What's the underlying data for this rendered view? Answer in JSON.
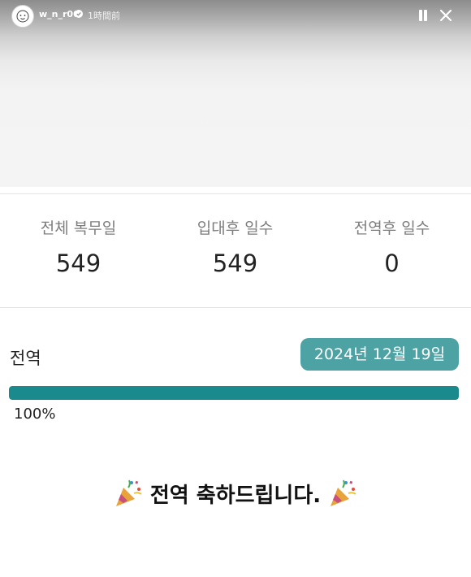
{
  "story": {
    "username": "w_n_r00",
    "time_ago": "1時間前"
  },
  "stats": [
    {
      "label": "전체 복무일",
      "value": "549"
    },
    {
      "label": "입대후 일수",
      "value": "549"
    },
    {
      "label": "전역후 일수",
      "value": "0"
    }
  ],
  "status": {
    "label": "전역",
    "date": "2024년 12월 19일",
    "progress_percent": 100,
    "progress_text": "100%"
  },
  "congrats": {
    "message": "전역 축하드립니다."
  },
  "colors": {
    "accent": "#1a8a8c",
    "badge": "#4da2a4"
  },
  "icons": [
    "avatar",
    "verified-icon",
    "pause-icon",
    "close-icon",
    "party-popper-icon"
  ]
}
